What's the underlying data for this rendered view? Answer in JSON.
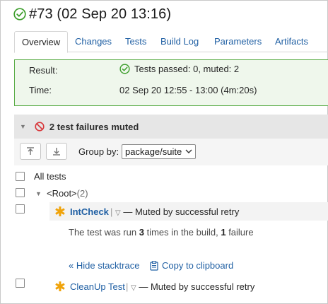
{
  "header": {
    "title": "#73 (02 Sep 20 13:16)",
    "status_icon": "check-circle-icon",
    "status_color": "#3d9e2c"
  },
  "tabs": [
    {
      "label": "Overview",
      "active": true
    },
    {
      "label": "Changes"
    },
    {
      "label": "Tests"
    },
    {
      "label": "Build Log"
    },
    {
      "label": "Parameters"
    },
    {
      "label": "Artifacts"
    }
  ],
  "summary": {
    "result_label": "Result:",
    "result_value": "Tests passed: 0, muted: 2",
    "time_label": "Time:",
    "time_value": "02 Sep 20 12:55 - 13:00 (4m:20s)",
    "border_color": "#5bad48",
    "bg_color": "#eff7ec"
  },
  "failures": {
    "heading": "2 test failures muted",
    "icon": "muted-circle-icon",
    "group_by_label": "Group by:",
    "group_by_value": "package/suite"
  },
  "tree": {
    "all_tests_label": "All tests",
    "root_label": "<Root>",
    "root_count": "(2)",
    "tests": [
      {
        "name": "IntCheck",
        "status": "— Muted by successful retry",
        "info_pre": "The test was run ",
        "runs": "3",
        "info_mid": " times in the build, ",
        "failures": "1",
        "info_post": " failure",
        "hide_stacktrace": "« Hide stacktrace",
        "copy_clipboard": "Copy to clipboard"
      },
      {
        "name": "CleanUp Test",
        "status": "— Muted by successful retry"
      }
    ]
  }
}
